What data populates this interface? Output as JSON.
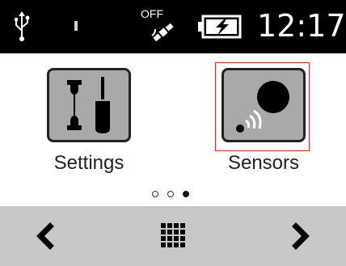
{
  "status_bar": {
    "gps_state": "OFF",
    "time": "12:17",
    "icons": [
      "usb-icon",
      "signal-icon",
      "gps-satellite-icon",
      "battery-charging-icon"
    ]
  },
  "apps": [
    {
      "label": "Settings",
      "icon": "tools-icon",
      "selected": false
    },
    {
      "label": "Sensors",
      "icon": "sensor-icon",
      "selected": true
    }
  ],
  "pager": {
    "pages": 3,
    "current": 3
  },
  "nav": {
    "icons": [
      "chevron-left-icon",
      "app-grid-icon",
      "chevron-right-icon"
    ]
  },
  "colors": {
    "status_bg": "#000000",
    "tile_bg": "#a9a9a9",
    "selection": "#e02424",
    "nav_bg": "#c8c8c8"
  }
}
